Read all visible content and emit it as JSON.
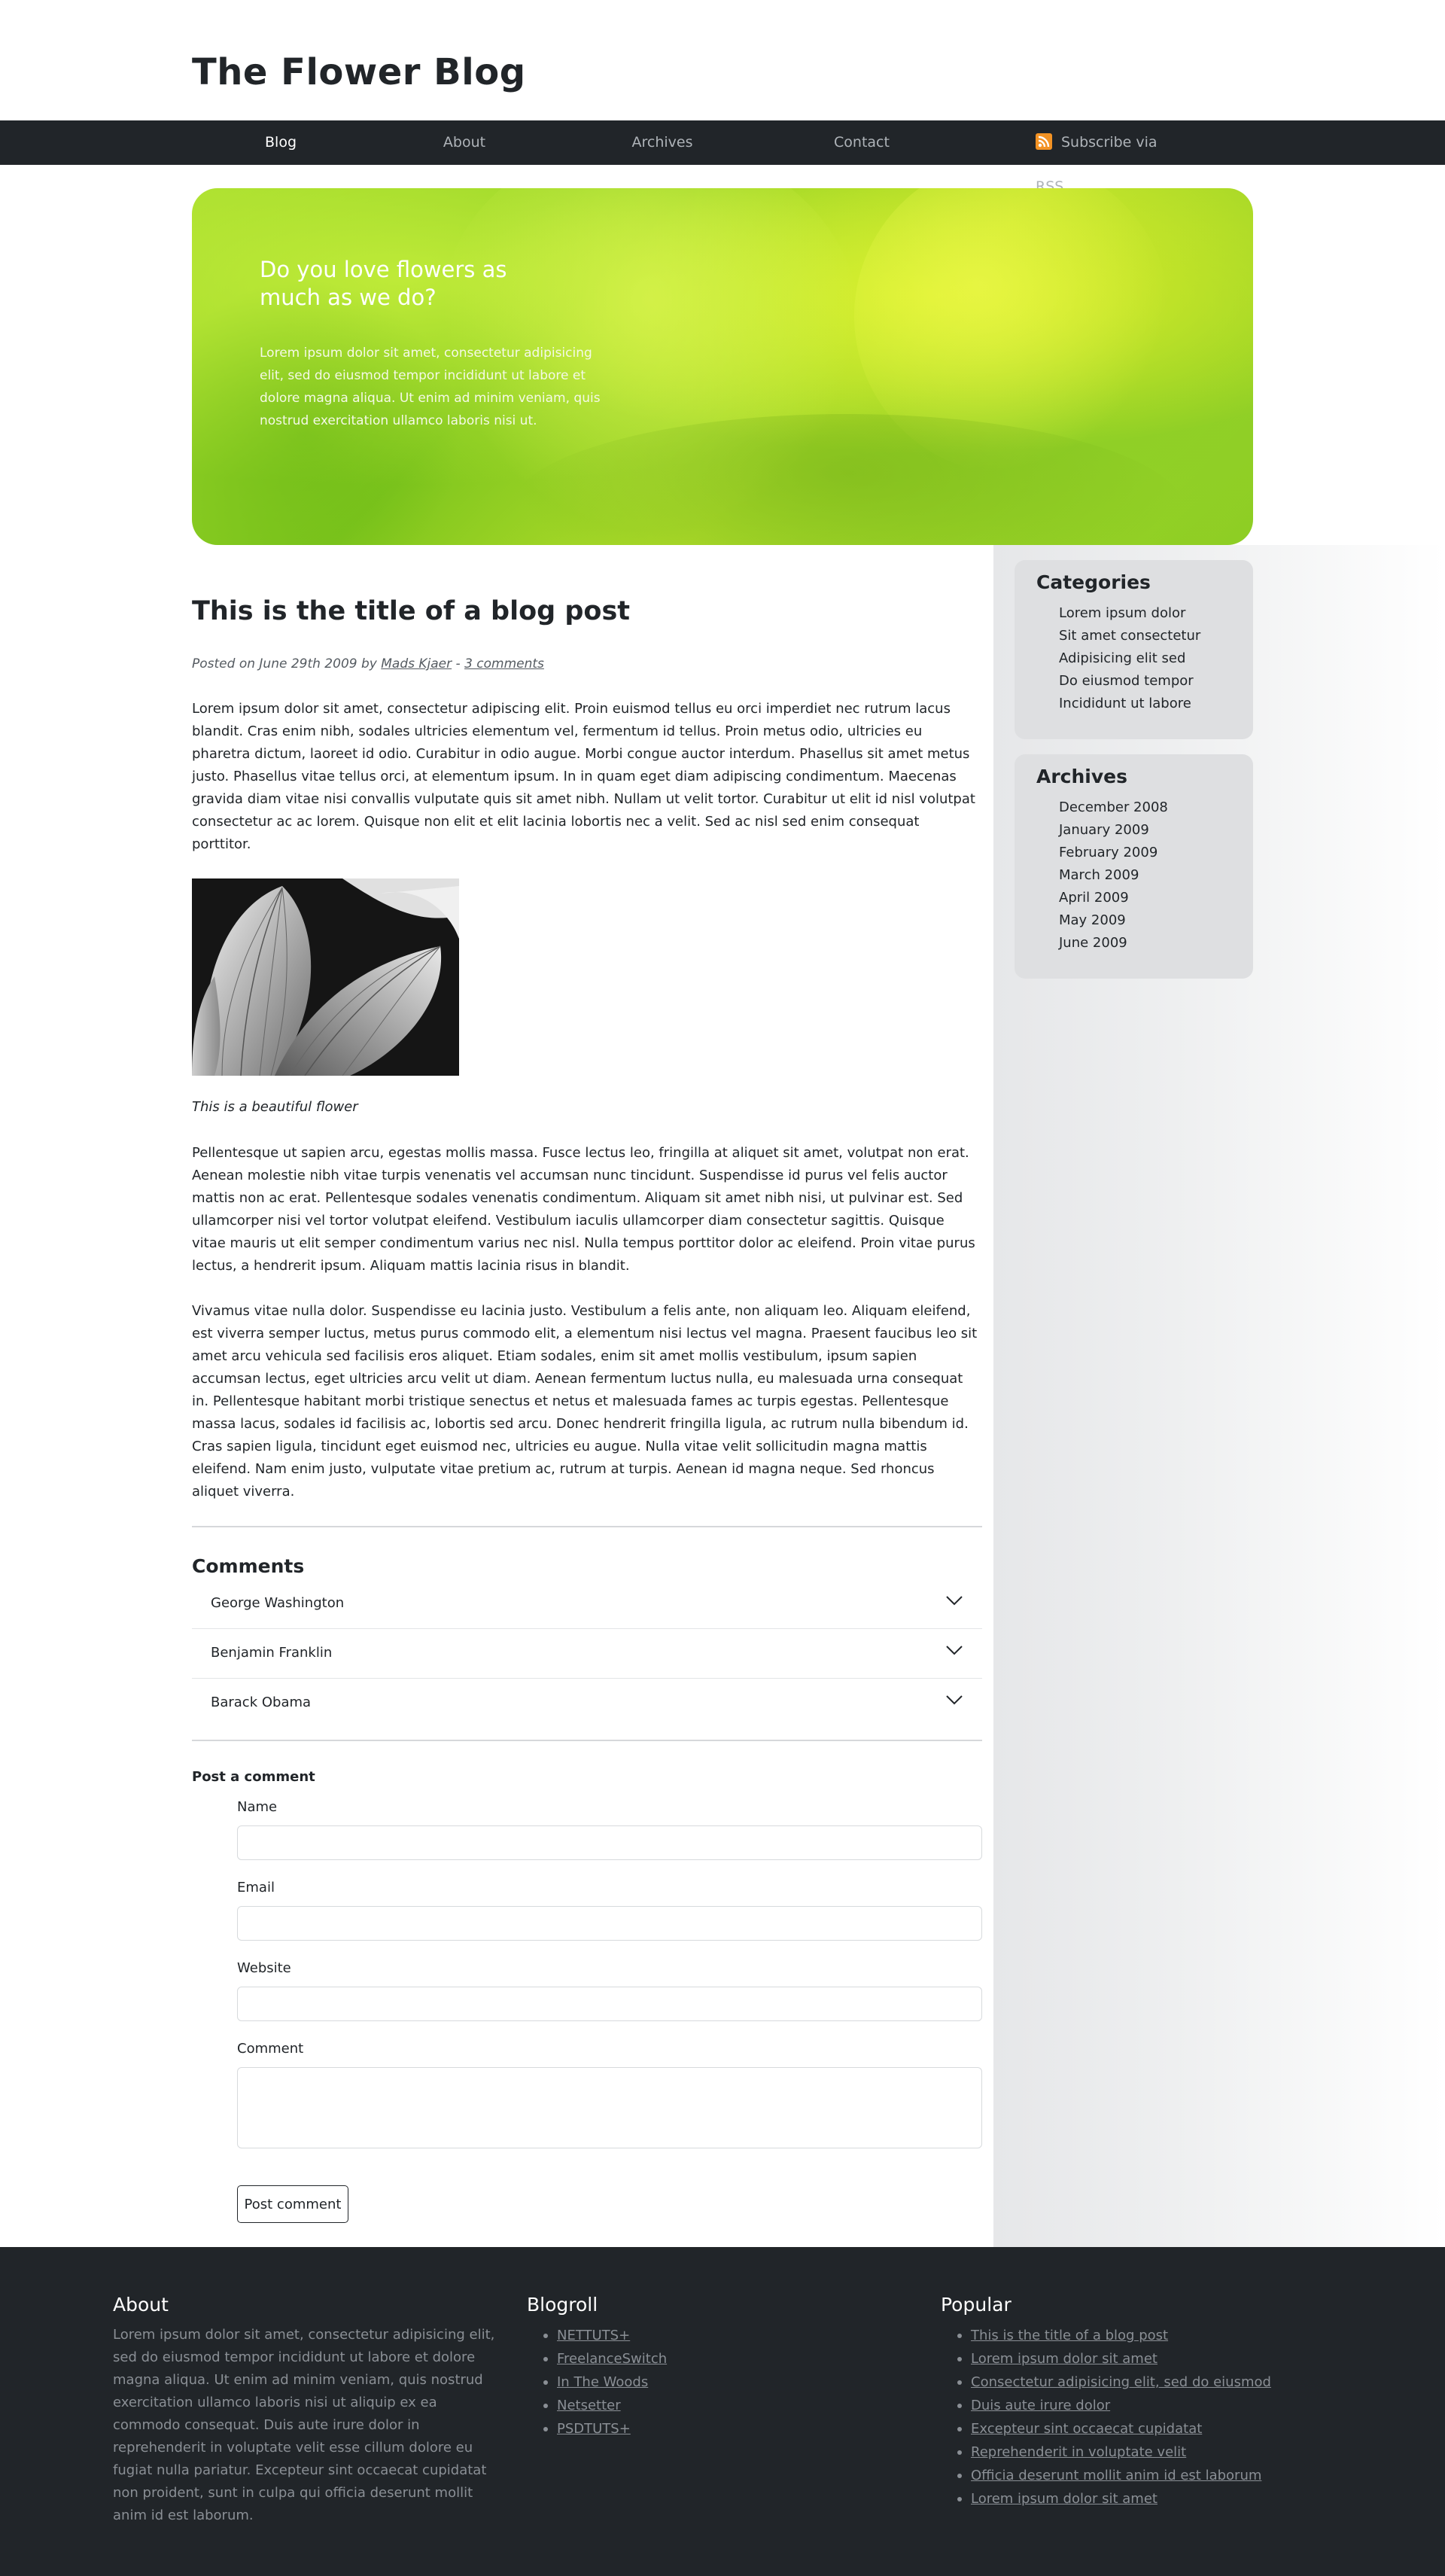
{
  "site": {
    "title": "The Flower Blog"
  },
  "nav": {
    "items": [
      "Blog",
      "About",
      "Archives",
      "Contact"
    ],
    "active": "Blog",
    "rss_label": "Subscribe via RSS"
  },
  "hero": {
    "title": "Do you love flowers as much as we do?",
    "text": "Lorem ipsum dolor sit amet, consectetur adipisicing elit, sed do eiusmod tempor incididunt ut labore et dolore magna aliqua. Ut enim ad minim veniam, quis nostrud exercitation ullamco laboris nisi ut."
  },
  "post": {
    "title": "This is the title of a blog post",
    "meta_prefix": "Posted on June 29th 2009 by",
    "author": "Mads Kjaer",
    "meta_separator": "-",
    "comments_link": "3 comments",
    "paragraph1": "Lorem ipsum dolor sit amet, consectetur adipiscing elit. Proin euismod tellus eu orci imperdiet nec rutrum lacus blandit. Cras enim nibh, sodales ultricies elementum vel, fermentum id tellus. Proin metus odio, ultricies eu pharetra dictum, laoreet id odio. Curabitur in odio augue. Morbi congue auctor interdum. Phasellus sit amet metus justo. Phasellus vitae tellus orci, at elementum ipsum. In in quam eget diam adipiscing condimentum. Maecenas gravida diam vitae nisi convallis vulputate quis sit amet nibh. Nullam ut velit tortor. Curabitur ut elit id nisl volutpat consectetur ac ac lorem. Quisque non elit et elit lacinia lobortis nec a velit. Sed ac nisl sed enim consequat porttitor.",
    "image_caption": "This is a beautiful flower",
    "paragraph2": "Pellentesque ut sapien arcu, egestas mollis massa. Fusce lectus leo, fringilla at aliquet sit amet, volutpat non erat. Aenean molestie nibh vitae turpis venenatis vel accumsan nunc tincidunt. Suspendisse id purus vel felis auctor mattis non ac erat. Pellentesque sodales venenatis condimentum. Aliquam sit amet nibh nisi, ut pulvinar est. Sed ullamcorper nisi vel tortor volutpat eleifend. Vestibulum iaculis ullamcorper diam consectetur sagittis. Quisque vitae mauris ut elit semper condimentum varius nec nisl. Nulla tempus porttitor dolor ac eleifend. Proin vitae purus lectus, a hendrerit ipsum. Aliquam mattis lacinia risus in blandit.",
    "paragraph3": "Vivamus vitae nulla dolor. Suspendisse eu lacinia justo. Vestibulum a felis ante, non aliquam leo. Aliquam eleifend, est viverra semper luctus, metus purus commodo elit, a elementum nisi lectus vel magna. Praesent faucibus leo sit amet arcu vehicula sed facilisis eros aliquet. Etiam sodales, enim sit amet mollis vestibulum, ipsum sapien accumsan lectus, eget ultricies arcu velit ut diam. Aenean fermentum luctus nulla, eu malesuada urna consequat in. Pellentesque habitant morbi tristique senectus et netus et malesuada fames ac turpis egestas. Pellentesque massa lacus, sodales id facilisis ac, lobortis sed arcu. Donec hendrerit fringilla ligula, ac rutrum nulla bibendum id. Cras sapien ligula, tincidunt eget euismod nec, ultricies eu augue. Nulla vitae velit sollicitudin magna mattis eleifend. Nam enim justo, vulputate vitae pretium ac, rutrum at turpis. Aenean id magna neque. Sed rhoncus aliquet viverra."
  },
  "comments": {
    "heading": "Comments",
    "items": [
      "George Washington",
      "Benjamin Franklin",
      "Barack Obama"
    ]
  },
  "form": {
    "heading": "Post a comment",
    "name_label": "Name",
    "email_label": "Email",
    "website_label": "Website",
    "comment_label": "Comment",
    "submit_label": "Post comment"
  },
  "sidebar": {
    "categories": {
      "title": "Categories",
      "items": [
        "Lorem ipsum dolor",
        "Sit amet consectetur",
        "Adipisicing elit sed",
        "Do eiusmod tempor",
        "Incididunt ut labore"
      ]
    },
    "archives": {
      "title": "Archives",
      "items": [
        "December 2008",
        "January 2009",
        "February 2009",
        "March 2009",
        "April 2009",
        "May 2009",
        "June 2009"
      ]
    }
  },
  "footer": {
    "about": {
      "title": "About",
      "text": "Lorem ipsum dolor sit amet, consectetur adipisicing elit, sed do eiusmod tempor incididunt ut labore et dolore magna aliqua. Ut enim ad minim veniam, quis nostrud exercitation ullamco laboris nisi ut aliquip ex ea commodo consequat. Duis aute irure dolor in reprehenderit in voluptate velit esse cillum dolore eu fugiat nulla pariatur. Excepteur sint occaecat cupidatat non proident, sunt in culpa qui officia deserunt mollit anim id est laborum."
    },
    "blogroll": {
      "title": "Blogroll",
      "items": [
        "NETTUTS+",
        "FreelanceSwitch",
        "In The Woods",
        "Netsetter",
        "PSDTUTS+"
      ]
    },
    "popular": {
      "title": "Popular",
      "items": [
        "This is the title of a blog post",
        "Lorem ipsum dolor sit amet",
        "Consectetur adipisicing elit, sed do eiusmod",
        "Duis aute irure dolor",
        "Excepteur sint occaecat cupidatat",
        "Reprehenderit in voluptate velit",
        "Officia deserunt mollit anim id est laborum",
        "Lorem ipsum dolor sit amet"
      ]
    }
  },
  "colors": {
    "nav_bg": "#212529",
    "footer_bg": "#212529",
    "rss_orange": "#f39324",
    "hero_green": "#9fd82a",
    "widget_bg": "#dedfe1"
  },
  "icons": {
    "rss": "rss-icon",
    "chevron": "chevron-down-icon"
  }
}
